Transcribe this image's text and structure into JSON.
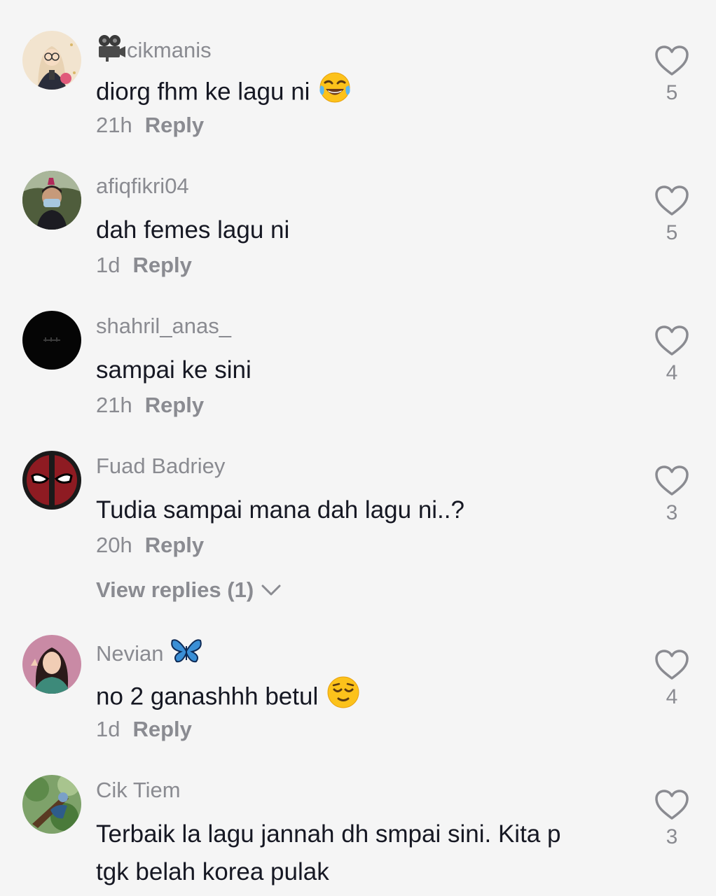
{
  "comments": [
    {
      "username": "cikmanis",
      "text": "diorg fhm ke lagu ni",
      "time": "21h",
      "reply_label": "Reply",
      "likes": "5"
    },
    {
      "username": "afiqfikri04",
      "text": "dah femes lagu ni",
      "time": "1d",
      "reply_label": "Reply",
      "likes": "5"
    },
    {
      "username": "shahril_anas_",
      "text": "sampai ke sini",
      "time": "21h",
      "reply_label": "Reply",
      "likes": "4"
    },
    {
      "username": "Fuad Badriey",
      "text": "Tudia sampai mana dah lagu ni..?",
      "time": "20h",
      "reply_label": "Reply",
      "likes": "3",
      "view_replies": "View replies (1)"
    },
    {
      "username": "Nevian",
      "text": "no 2 ganashhh betul",
      "time": "1d",
      "reply_label": "Reply",
      "likes": "4"
    },
    {
      "username": "Cik Tiem",
      "text_line1": "Terbaik la lagu jannah dh smpai sini. Kita p",
      "text_line2": "tgk belah korea pulak",
      "likes": "3"
    }
  ],
  "icons": {
    "like": "heart-outline-icon",
    "expand": "chevron-down-icon",
    "camera": "movie-camera-emoji",
    "laugh": "tears-of-joy-emoji",
    "butterfly": "butterfly-emoji",
    "relieved": "relieved-face-emoji"
  },
  "colors": {
    "background": "#f5f5f5",
    "primary_text": "#161823",
    "secondary_text": "#8a8b91"
  }
}
